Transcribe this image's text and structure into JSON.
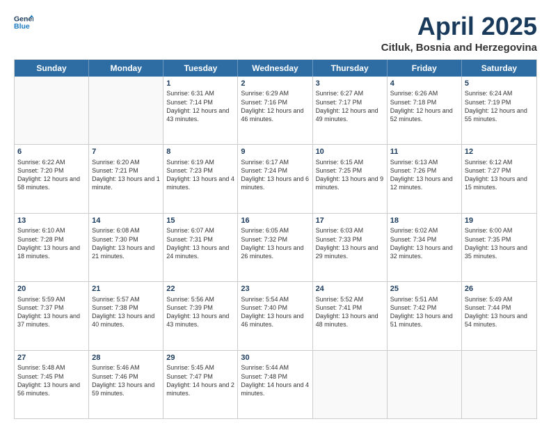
{
  "header": {
    "logo_line1": "General",
    "logo_line2": "Blue",
    "month": "April 2025",
    "location": "Citluk, Bosnia and Herzegovina"
  },
  "weekdays": [
    "Sunday",
    "Monday",
    "Tuesday",
    "Wednesday",
    "Thursday",
    "Friday",
    "Saturday"
  ],
  "rows": [
    [
      {
        "day": "",
        "sunrise": "",
        "sunset": "",
        "daylight": ""
      },
      {
        "day": "",
        "sunrise": "",
        "sunset": "",
        "daylight": ""
      },
      {
        "day": "1",
        "sunrise": "Sunrise: 6:31 AM",
        "sunset": "Sunset: 7:14 PM",
        "daylight": "Daylight: 12 hours and 43 minutes."
      },
      {
        "day": "2",
        "sunrise": "Sunrise: 6:29 AM",
        "sunset": "Sunset: 7:16 PM",
        "daylight": "Daylight: 12 hours and 46 minutes."
      },
      {
        "day": "3",
        "sunrise": "Sunrise: 6:27 AM",
        "sunset": "Sunset: 7:17 PM",
        "daylight": "Daylight: 12 hours and 49 minutes."
      },
      {
        "day": "4",
        "sunrise": "Sunrise: 6:26 AM",
        "sunset": "Sunset: 7:18 PM",
        "daylight": "Daylight: 12 hours and 52 minutes."
      },
      {
        "day": "5",
        "sunrise": "Sunrise: 6:24 AM",
        "sunset": "Sunset: 7:19 PM",
        "daylight": "Daylight: 12 hours and 55 minutes."
      }
    ],
    [
      {
        "day": "6",
        "sunrise": "Sunrise: 6:22 AM",
        "sunset": "Sunset: 7:20 PM",
        "daylight": "Daylight: 12 hours and 58 minutes."
      },
      {
        "day": "7",
        "sunrise": "Sunrise: 6:20 AM",
        "sunset": "Sunset: 7:21 PM",
        "daylight": "Daylight: 13 hours and 1 minute."
      },
      {
        "day": "8",
        "sunrise": "Sunrise: 6:19 AM",
        "sunset": "Sunset: 7:23 PM",
        "daylight": "Daylight: 13 hours and 4 minutes."
      },
      {
        "day": "9",
        "sunrise": "Sunrise: 6:17 AM",
        "sunset": "Sunset: 7:24 PM",
        "daylight": "Daylight: 13 hours and 6 minutes."
      },
      {
        "day": "10",
        "sunrise": "Sunrise: 6:15 AM",
        "sunset": "Sunset: 7:25 PM",
        "daylight": "Daylight: 13 hours and 9 minutes."
      },
      {
        "day": "11",
        "sunrise": "Sunrise: 6:13 AM",
        "sunset": "Sunset: 7:26 PM",
        "daylight": "Daylight: 13 hours and 12 minutes."
      },
      {
        "day": "12",
        "sunrise": "Sunrise: 6:12 AM",
        "sunset": "Sunset: 7:27 PM",
        "daylight": "Daylight: 13 hours and 15 minutes."
      }
    ],
    [
      {
        "day": "13",
        "sunrise": "Sunrise: 6:10 AM",
        "sunset": "Sunset: 7:28 PM",
        "daylight": "Daylight: 13 hours and 18 minutes."
      },
      {
        "day": "14",
        "sunrise": "Sunrise: 6:08 AM",
        "sunset": "Sunset: 7:30 PM",
        "daylight": "Daylight: 13 hours and 21 minutes."
      },
      {
        "day": "15",
        "sunrise": "Sunrise: 6:07 AM",
        "sunset": "Sunset: 7:31 PM",
        "daylight": "Daylight: 13 hours and 24 minutes."
      },
      {
        "day": "16",
        "sunrise": "Sunrise: 6:05 AM",
        "sunset": "Sunset: 7:32 PM",
        "daylight": "Daylight: 13 hours and 26 minutes."
      },
      {
        "day": "17",
        "sunrise": "Sunrise: 6:03 AM",
        "sunset": "Sunset: 7:33 PM",
        "daylight": "Daylight: 13 hours and 29 minutes."
      },
      {
        "day": "18",
        "sunrise": "Sunrise: 6:02 AM",
        "sunset": "Sunset: 7:34 PM",
        "daylight": "Daylight: 13 hours and 32 minutes."
      },
      {
        "day": "19",
        "sunrise": "Sunrise: 6:00 AM",
        "sunset": "Sunset: 7:35 PM",
        "daylight": "Daylight: 13 hours and 35 minutes."
      }
    ],
    [
      {
        "day": "20",
        "sunrise": "Sunrise: 5:59 AM",
        "sunset": "Sunset: 7:37 PM",
        "daylight": "Daylight: 13 hours and 37 minutes."
      },
      {
        "day": "21",
        "sunrise": "Sunrise: 5:57 AM",
        "sunset": "Sunset: 7:38 PM",
        "daylight": "Daylight: 13 hours and 40 minutes."
      },
      {
        "day": "22",
        "sunrise": "Sunrise: 5:56 AM",
        "sunset": "Sunset: 7:39 PM",
        "daylight": "Daylight: 13 hours and 43 minutes."
      },
      {
        "day": "23",
        "sunrise": "Sunrise: 5:54 AM",
        "sunset": "Sunset: 7:40 PM",
        "daylight": "Daylight: 13 hours and 46 minutes."
      },
      {
        "day": "24",
        "sunrise": "Sunrise: 5:52 AM",
        "sunset": "Sunset: 7:41 PM",
        "daylight": "Daylight: 13 hours and 48 minutes."
      },
      {
        "day": "25",
        "sunrise": "Sunrise: 5:51 AM",
        "sunset": "Sunset: 7:42 PM",
        "daylight": "Daylight: 13 hours and 51 minutes."
      },
      {
        "day": "26",
        "sunrise": "Sunrise: 5:49 AM",
        "sunset": "Sunset: 7:44 PM",
        "daylight": "Daylight: 13 hours and 54 minutes."
      }
    ],
    [
      {
        "day": "27",
        "sunrise": "Sunrise: 5:48 AM",
        "sunset": "Sunset: 7:45 PM",
        "daylight": "Daylight: 13 hours and 56 minutes."
      },
      {
        "day": "28",
        "sunrise": "Sunrise: 5:46 AM",
        "sunset": "Sunset: 7:46 PM",
        "daylight": "Daylight: 13 hours and 59 minutes."
      },
      {
        "day": "29",
        "sunrise": "Sunrise: 5:45 AM",
        "sunset": "Sunset: 7:47 PM",
        "daylight": "Daylight: 14 hours and 2 minutes."
      },
      {
        "day": "30",
        "sunrise": "Sunrise: 5:44 AM",
        "sunset": "Sunset: 7:48 PM",
        "daylight": "Daylight: 14 hours and 4 minutes."
      },
      {
        "day": "",
        "sunrise": "",
        "sunset": "",
        "daylight": ""
      },
      {
        "day": "",
        "sunrise": "",
        "sunset": "",
        "daylight": ""
      },
      {
        "day": "",
        "sunrise": "",
        "sunset": "",
        "daylight": ""
      }
    ]
  ]
}
